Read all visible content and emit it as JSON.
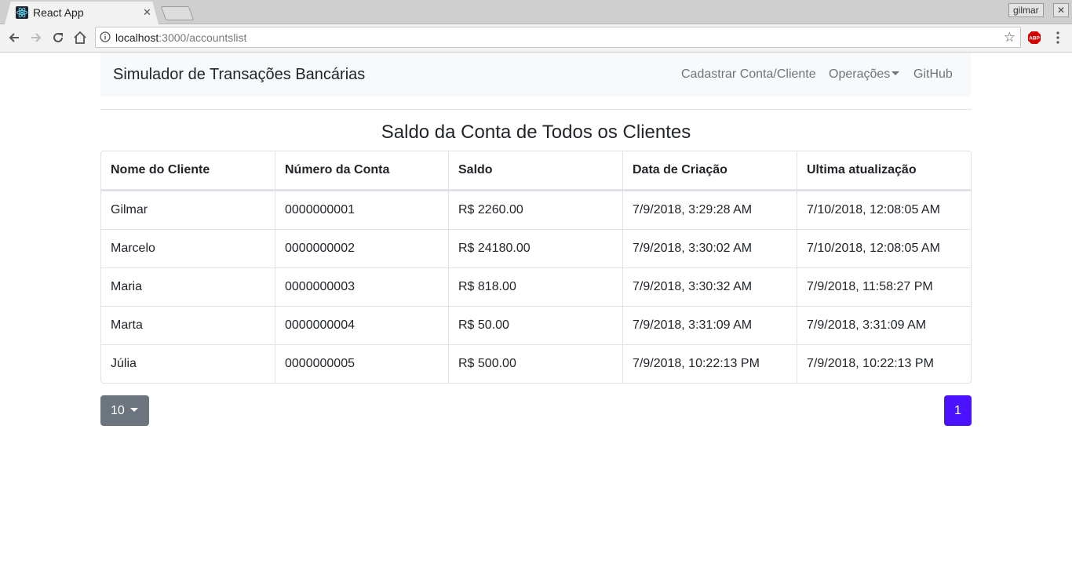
{
  "browser": {
    "tab_title": "React App",
    "tab_close": "✕",
    "profile_name": "gilmar",
    "window_close": "✕",
    "url_host": "localhost",
    "url_path": ":3000/accountslist",
    "star": "☆",
    "adblock_label": "ABP"
  },
  "navbar": {
    "brand": "Simulador de Transações Bancárias",
    "links": [
      "Cadastrar Conta/Cliente",
      "Operações",
      "GitHub"
    ]
  },
  "page_title": "Saldo da Conta de Todos os Clientes",
  "table": {
    "headers": [
      "Nome do Cliente",
      "Número da Conta",
      "Saldo",
      "Data de Criação",
      "Ultima atualização"
    ],
    "rows": [
      [
        "Gilmar",
        "0000000001",
        "R$ 2260.00",
        "7/9/2018, 3:29:28 AM",
        "7/10/2018, 12:08:05 AM"
      ],
      [
        "Marcelo",
        "0000000002",
        "R$ 24180.00",
        "7/9/2018, 3:30:02 AM",
        "7/10/2018, 12:08:05 AM"
      ],
      [
        "Maria",
        "0000000003",
        "R$ 818.00",
        "7/9/2018, 3:30:32 AM",
        "7/9/2018, 11:58:27 PM"
      ],
      [
        "Marta",
        "0000000004",
        "R$ 50.00",
        "7/9/2018, 3:31:09 AM",
        "7/9/2018, 3:31:09 AM"
      ],
      [
        "Júlia",
        "0000000005",
        "R$ 500.00",
        "7/9/2018, 10:22:13 PM",
        "7/9/2018, 10:22:13 PM"
      ]
    ]
  },
  "pagination": {
    "page_size": "10",
    "current_page": "1"
  },
  "colors": {
    "navbar_bg": "#f8f9fa",
    "page_button": "#4a12ff",
    "size_button": "#6c757d"
  }
}
